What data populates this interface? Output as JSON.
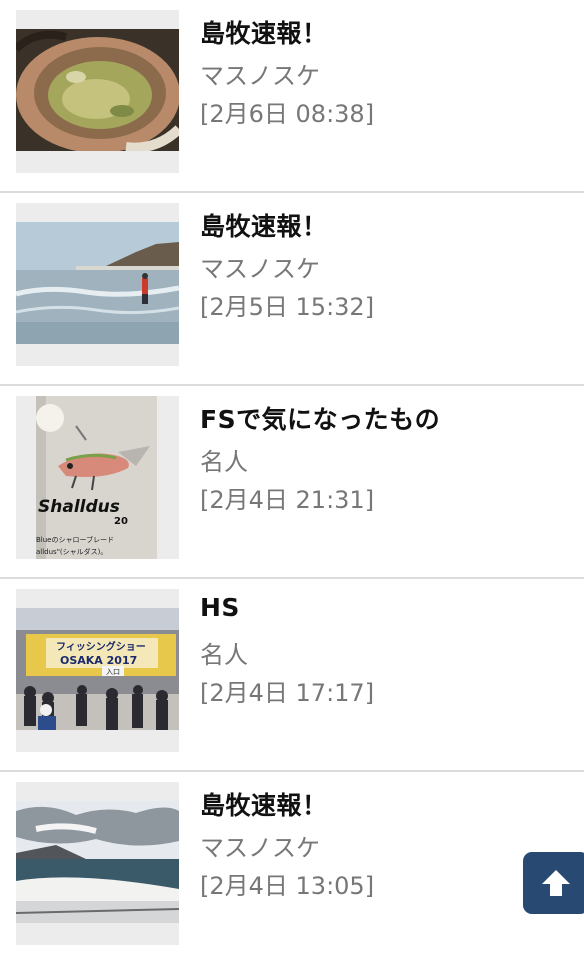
{
  "posts": [
    {
      "title": "島牧速報！",
      "author": "マスノスケ",
      "date": "[2月6日 08:38]",
      "thumb": "crab-shell-photo-icon"
    },
    {
      "title": "島牧速報！",
      "author": "マスノスケ",
      "date": "[2月5日 15:32]",
      "thumb": "beach-angler-photo-icon"
    },
    {
      "title": "FSで気になったもの",
      "author": "名人",
      "date": "[2月4日 21:31]",
      "thumb": "lure-catalog-photo-icon"
    },
    {
      "title": "HS",
      "author": "名人",
      "date": "[2月4日 17:17]",
      "thumb": "fishing-show-photo-icon"
    },
    {
      "title": "島牧速報！",
      "author": "マスノスケ",
      "date": "[2月4日 13:05]",
      "thumb": "snowy-coast-photo-icon"
    }
  ],
  "thumb_text": {
    "lure_brand": "Shalldus",
    "lure_model": "20",
    "lure_caption_1": "Blueのシャローブレード",
    "lure_caption_2": "alldus\"(シャルダス)。",
    "show_banner_1": "フィッシングショー",
    "show_banner_2": "OSAKA 2017",
    "show_entrance": "入口"
  },
  "scroll_top_button": {
    "icon": "arrow-up-icon",
    "color": "#284a72"
  }
}
